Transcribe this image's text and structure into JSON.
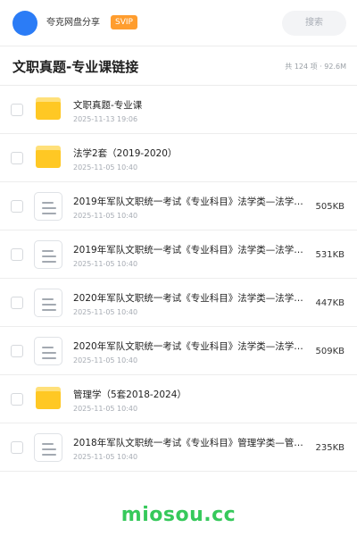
{
  "header": {
    "brand": "夸克网盘分享",
    "badge": "SVIP",
    "search_placeholder": "搜索"
  },
  "title_bar": {
    "title": "文职真题-专业课链接",
    "meta": "共 124 项 · 92.6M"
  },
  "files": [
    {
      "type": "folder",
      "name": "文职真题-专业课",
      "date": "2025-11-13 19:06",
      "size": ""
    },
    {
      "type": "folder",
      "name": "法学2套（2019-2020）",
      "date": "2025-11-05 10:40",
      "size": ""
    },
    {
      "type": "doc",
      "name": "2019年军队文职统一考试《专业科目》法学类—法学…",
      "date": "2025-11-05 10:40",
      "size": "505KB"
    },
    {
      "type": "doc",
      "name": "2019年军队文职统一考试《专业科目》法学类—法学…",
      "date": "2025-11-05 10:40",
      "size": "531KB"
    },
    {
      "type": "doc",
      "name": "2020年军队文职统一考试《专业科目》法学类—法学…",
      "date": "2025-11-05 10:40",
      "size": "447KB"
    },
    {
      "type": "doc",
      "name": "2020年军队文职统一考试《专业科目》法学类—法学…",
      "date": "2025-11-05 10:40",
      "size": "509KB"
    },
    {
      "type": "folder",
      "name": "管理学（5套2018-2024）",
      "date": "2025-11-05 10:40",
      "size": ""
    },
    {
      "type": "doc",
      "name": "2018年军队文职统一考试《专业科目》管理学类—管…",
      "date": "2025-11-05 10:40",
      "size": "235KB"
    }
  ],
  "watermark": "miosou.cc",
  "colors": {
    "accent": "#2b7cf6",
    "badge": "#ff9d2e",
    "folder": "#ffc824",
    "watermark": "#36c95b"
  }
}
